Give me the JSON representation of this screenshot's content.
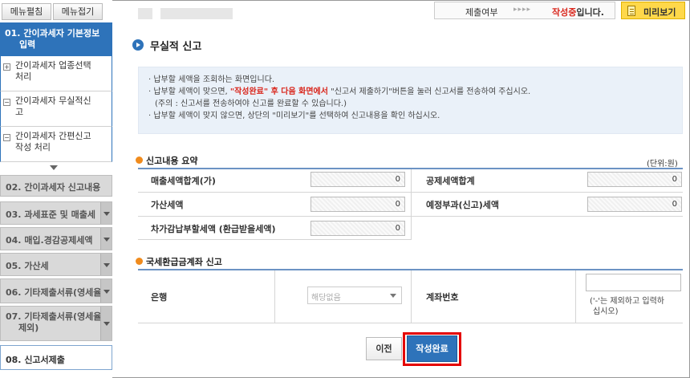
{
  "sidebar": {
    "expand_label": "메뉴펼침",
    "collapse_label": "메뉴접기",
    "current": {
      "line1": "01. 간이과세자 기본정보",
      "line2": "입력"
    },
    "subitems": [
      {
        "line1": "간이과세자 업종선택",
        "line2": "처리",
        "mark": "+"
      },
      {
        "line1": "간이과세자 무실적신",
        "line2": "고",
        "mark": "−"
      },
      {
        "line1": "간이과세자 간편신고",
        "line2": "작성 처리",
        "mark": "−"
      }
    ],
    "items": [
      {
        "line1": "02. 간이과세자 신고내용",
        "line2": ""
      },
      {
        "line1": "03. 과세표준 및 매출세",
        "line2": ""
      },
      {
        "line1": "04. 매입.경감공제세액",
        "line2": ""
      },
      {
        "line1": "05. 가산세",
        "line2": ""
      },
      {
        "line1": "06. 기타제출서류(영세율",
        "line2": ""
      },
      {
        "line1": "07. 기타제출서류(영세율",
        "line2": "제외)"
      }
    ],
    "last": "08. 신고서제출"
  },
  "topbar": {
    "submit_label": "제출여부",
    "arrows": "▸▸▸▸",
    "status_prefix": "작성중",
    "status_suffix": "입니다.",
    "preview_label": "미리보기"
  },
  "page_title": "무실적 신고",
  "info": {
    "line1": "· 납부할 세액을 조회하는 화면입니다.",
    "line2a": "· 납부할 세액이 맞으면, ",
    "line2b": "\"작성완료\" 후 다음 화면에서",
    "line2c": " \"신고서 제출하기\"버튼을 눌러 신고서를 전송하여 주십시오.",
    "line3": "(주의 : 신고서를 전송하여야 신고를 완료할 수 있습니다.)",
    "line4": "· 납부할 세액이 맞지 않으면, 상단의 \"미리보기\"를 선택하여 신고내용을 확인 하십시오."
  },
  "summary": {
    "title": "신고내용 요약",
    "unit": "(단위:원)",
    "sales_tax_label": "매출세액합계(가)",
    "sales_tax_value": "0",
    "deduction_label": "공제세액합계",
    "deduction_value": "0",
    "penalty_label": "가산세액",
    "penalty_value": "0",
    "prenotice_label": "예정부과(신고)세액",
    "prenotice_value": "0",
    "net_label": "차가감납부할세액 (환급받을세액)",
    "net_value": "0"
  },
  "refund": {
    "title": "국세환급금계좌 신고",
    "bank_label": "은행",
    "bank_value": "해당없음",
    "account_label": "계좌번호",
    "hint_line1": "('-'는 제외하고 입력하",
    "hint_line2": "십시오)"
  },
  "buttons": {
    "prev": "이전",
    "done": "작성완료"
  }
}
